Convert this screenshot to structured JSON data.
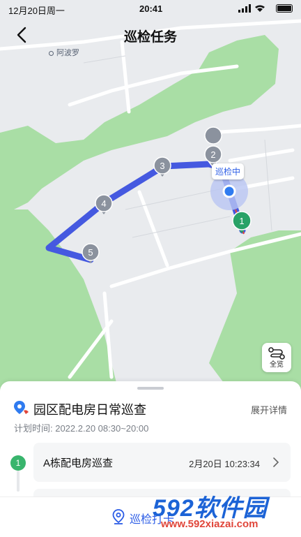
{
  "status_bar": {
    "date": "12月20日周一",
    "time": "20:41"
  },
  "nav": {
    "title": "巡检任务"
  },
  "map": {
    "place_label": "阿波罗",
    "patrol_status": "巡检中",
    "overview_label": "全览",
    "markers": [
      "1",
      "2",
      "3",
      "4",
      "5"
    ],
    "colors": {
      "route": "#4559e0",
      "green_area": "#a9dea5",
      "marker": "#8b929e",
      "start_marker": "#29a267"
    }
  },
  "task": {
    "title": "园区配电房日常巡查",
    "detail_link": "展开详情",
    "plan_time": "计划时间: 2022.2.20 08:30~20:00",
    "items": [
      {
        "step": "1",
        "name": "A栋配电房巡查",
        "time": "2月20日 10:23:34"
      }
    ]
  },
  "action": {
    "checkin_label": "巡检打卡"
  },
  "watermark": {
    "brand": "592软件园",
    "url": "www.592xiazai.com"
  }
}
